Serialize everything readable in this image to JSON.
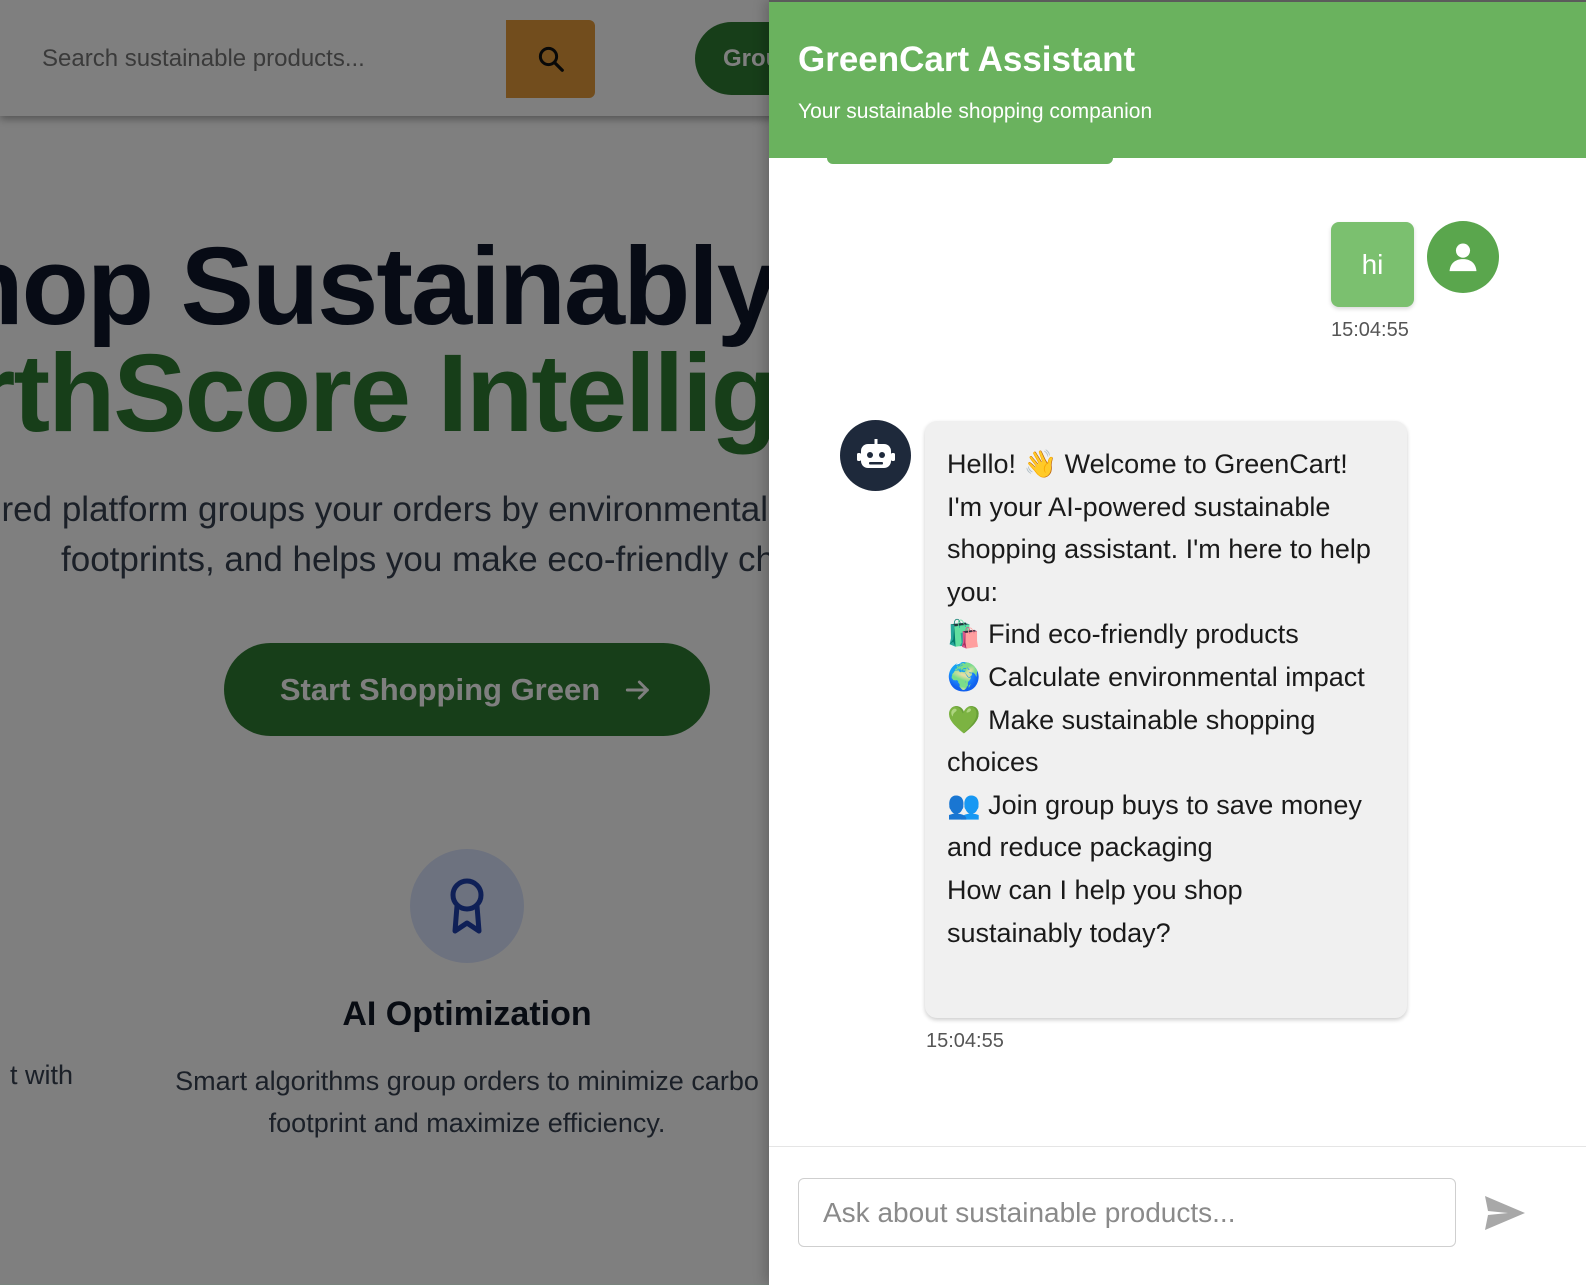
{
  "background_page": {
    "search": {
      "placeholder": "Search sustainable products..."
    },
    "group_button_label": "Grou",
    "hero": {
      "title_line1": "hop Sustainably",
      "title_line2": "rthScore Intellig",
      "subtitle_line1": "red platform groups your orders by environmental",
      "subtitle_line2": "footprints, and helps you make eco-friendly ch"
    },
    "cta_label": "Start Shopping Green",
    "feature": {
      "icon": "award-ribbon-icon",
      "title": "AI Optimization",
      "description": "Smart algorithms group orders to minimize carbo\nfootprint and maximize efficiency.",
      "left_fragment": "t with"
    }
  },
  "chat": {
    "title": "GreenCart Assistant",
    "subtitle": "Your sustainable shopping companion",
    "header_color": "#6ab25e",
    "messages": [
      {
        "sender": "user",
        "text": "hi",
        "time": "15:04:55"
      },
      {
        "sender": "bot",
        "lines": [
          "Hello! 👋 Welcome to GreenCart!",
          "I'm your AI-powered sustainable shopping assistant. I'm here to help you:",
          "🛍️ Find eco-friendly products",
          "🌍 Calculate environmental impact",
          "💚 Make sustainable shopping choices",
          "👥 Join group buys to save money and reduce packaging",
          "How can I help you shop sustainably today?"
        ],
        "time": "15:04:55"
      }
    ],
    "input": {
      "placeholder": "Ask about sustainable products...",
      "value": ""
    },
    "send_icon": "send-icon"
  }
}
